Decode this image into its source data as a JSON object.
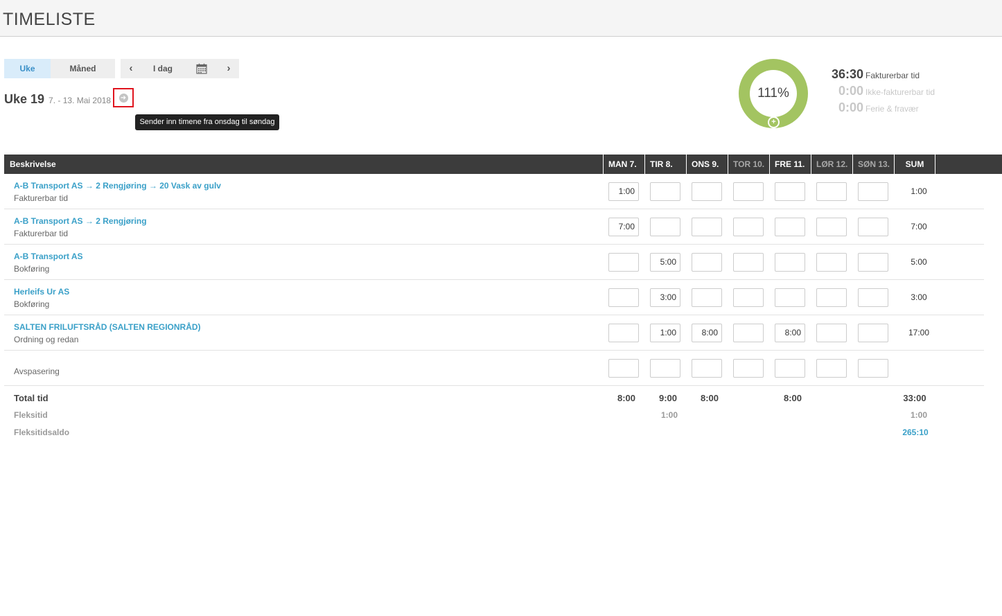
{
  "header": {
    "title": "TIMELISTE"
  },
  "toolbar": {
    "week_label": "Uke",
    "month_label": "Måned",
    "prev_label": "‹",
    "today_label": "I dag",
    "next_label": "›"
  },
  "week": {
    "label": "Uke 19",
    "range": "7. - 13. Mai 2018",
    "submit_tooltip": "Sender inn timene fra onsdag til søndag"
  },
  "summary": {
    "percent": "111%",
    "billable_value": "36:30",
    "billable_label": "Fakturerbar tid",
    "nonbillable_value": "0:00",
    "nonbillable_label": "Ikke-fakturerbar tid",
    "leave_value": "0:00",
    "leave_label": "Ferie & fravær",
    "add_label": "+"
  },
  "table": {
    "desc_header": "Beskrivelse",
    "days": [
      {
        "label": "MAN 7.",
        "weekend": false
      },
      {
        "label": "TIR 8.",
        "weekend": false
      },
      {
        "label": "ONS 9.",
        "weekend": false
      },
      {
        "label": "TOR 10.",
        "weekend": true
      },
      {
        "label": "FRE 11.",
        "weekend": false
      },
      {
        "label": "LØR 12.",
        "weekend": true
      },
      {
        "label": "SØN 13.",
        "weekend": true
      }
    ],
    "sum_header": "SUM",
    "rows": [
      {
        "title": "A-B Transport AS → 2 Rengjøring → 20 Vask av gulv",
        "subtitle": "Fakturerbar tid",
        "cells": [
          "1:00",
          "",
          "",
          "",
          "",
          "",
          ""
        ],
        "sum": "1:00"
      },
      {
        "title": "A-B Transport AS → 2 Rengjøring",
        "subtitle": "Fakturerbar tid",
        "cells": [
          "7:00",
          "",
          "",
          "",
          "",
          "",
          ""
        ],
        "sum": "7:00"
      },
      {
        "title": "A-B Transport AS",
        "subtitle": "Bokføring",
        "cells": [
          "",
          "5:00",
          "",
          "",
          "",
          "",
          ""
        ],
        "sum": "5:00"
      },
      {
        "title": "Herleifs Ur AS",
        "subtitle": "Bokføring",
        "cells": [
          "",
          "3:00",
          "",
          "",
          "",
          "",
          ""
        ],
        "sum": "3:00"
      },
      {
        "title": "SALTEN FRILUFTSRÅD (SALTEN REGIONRÅD)",
        "subtitle": "Ordning og redan",
        "cells": [
          "",
          "1:00",
          "8:00",
          "",
          "8:00",
          "",
          ""
        ],
        "sum": "17:00"
      },
      {
        "title": "",
        "subtitle": "Avspasering",
        "cells": [
          "",
          "",
          "",
          "",
          "",
          "",
          ""
        ],
        "sum": ""
      }
    ],
    "totals": {
      "total_label": "Total tid",
      "total_values": [
        "8:00",
        "9:00",
        "8:00",
        "",
        "8:00",
        "",
        ""
      ],
      "total_sum": "33:00",
      "flex_label": "Fleksitid",
      "flex_values": [
        "",
        "1:00",
        "",
        "",
        "",
        "",
        ""
      ],
      "flex_sum": "1:00",
      "saldo_label": "Fleksitidsaldo",
      "saldo_sum": "265:10"
    }
  }
}
